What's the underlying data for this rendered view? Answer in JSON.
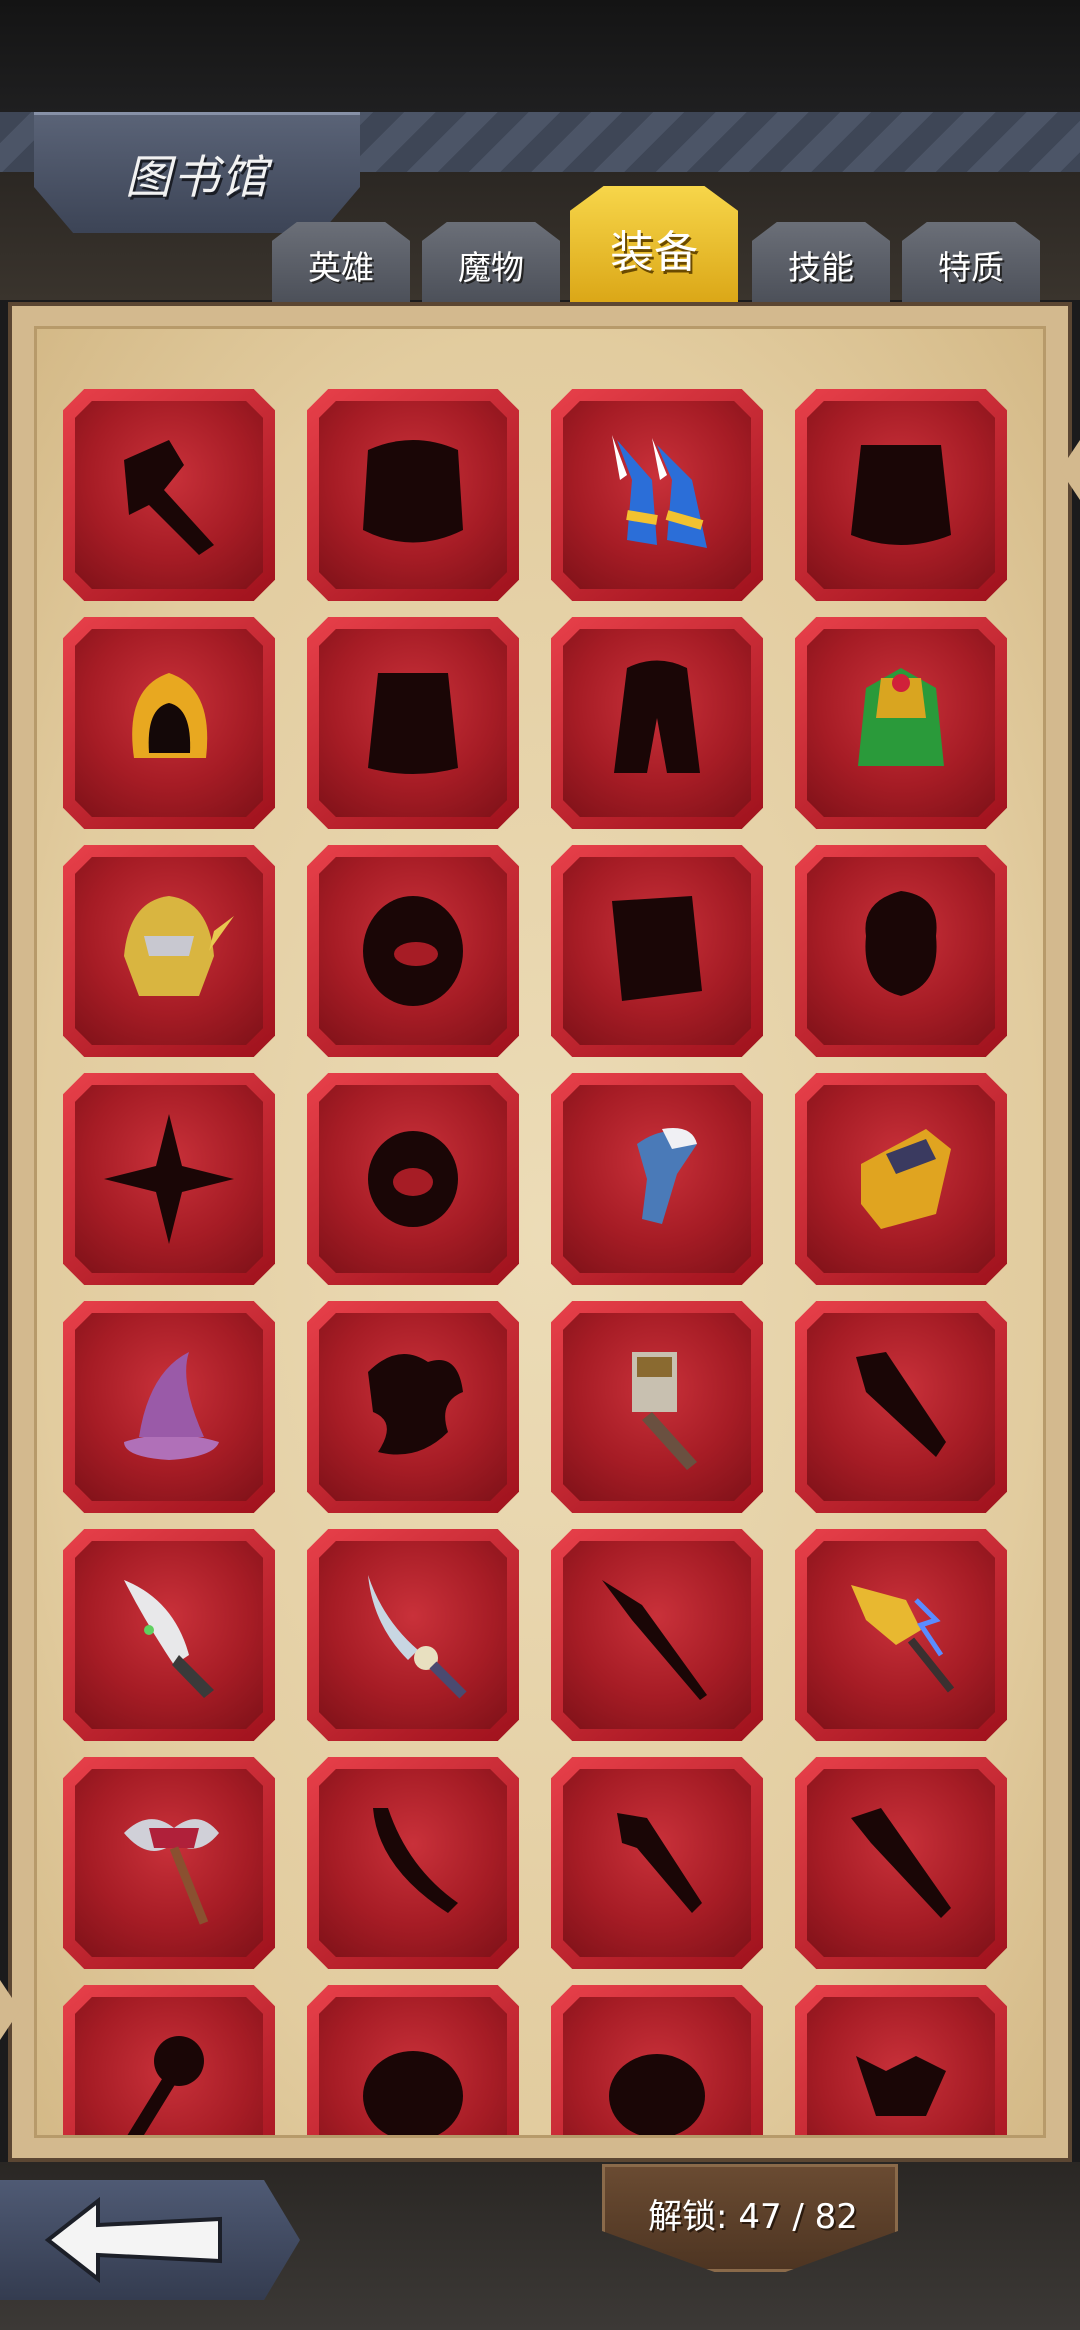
{
  "header": {
    "title": "图书馆"
  },
  "tabs": [
    {
      "label": "英雄",
      "active": false
    },
    {
      "label": "魔物",
      "active": false
    },
    {
      "label": "装备",
      "active": true
    },
    {
      "label": "技能",
      "active": false
    },
    {
      "label": "特质",
      "active": false
    }
  ],
  "unlock": {
    "text": "解锁: 47 / 82"
  },
  "colors": {
    "slot_red": "#b01d27",
    "tab_active": "#e8b824",
    "tab_inactive": "#5a5e67",
    "panel": "#e6d2a8"
  },
  "items": [
    {
      "name": "locked-axe",
      "unlocked": false,
      "icon": "axe-silhouette"
    },
    {
      "name": "locked-armor",
      "unlocked": false,
      "icon": "armor-silhouette"
    },
    {
      "name": "winged-boots",
      "unlocked": true,
      "icon": "winged-boots-icon"
    },
    {
      "name": "locked-cloak",
      "unlocked": false,
      "icon": "cloak-silhouette"
    },
    {
      "name": "golden-hood",
      "unlocked": true,
      "icon": "golden-hood-icon"
    },
    {
      "name": "locked-robe",
      "unlocked": false,
      "icon": "robe-silhouette"
    },
    {
      "name": "locked-cape",
      "unlocked": false,
      "icon": "cape-silhouette"
    },
    {
      "name": "jade-armor",
      "unlocked": true,
      "icon": "jade-armor-icon"
    },
    {
      "name": "golden-helmet",
      "unlocked": true,
      "icon": "golden-helmet-icon"
    },
    {
      "name": "locked-ring",
      "unlocked": false,
      "icon": "ring-silhouette"
    },
    {
      "name": "locked-tome",
      "unlocked": false,
      "icon": "tome-silhouette"
    },
    {
      "name": "locked-amulet",
      "unlocked": false,
      "icon": "amulet-silhouette"
    },
    {
      "name": "locked-shuriken",
      "unlocked": false,
      "icon": "shuriken-silhouette"
    },
    {
      "name": "locked-bracelet",
      "unlocked": false,
      "icon": "bracelet-silhouette"
    },
    {
      "name": "frost-claw",
      "unlocked": true,
      "icon": "frost-claw-icon"
    },
    {
      "name": "golden-gauntlet",
      "unlocked": true,
      "icon": "golden-gauntlet-icon"
    },
    {
      "name": "wizard-hat",
      "unlocked": true,
      "icon": "wizard-hat-icon"
    },
    {
      "name": "locked-dragon",
      "unlocked": false,
      "icon": "dragon-silhouette"
    },
    {
      "name": "war-hammer",
      "unlocked": true,
      "icon": "war-hammer-icon"
    },
    {
      "name": "locked-sword",
      "unlocked": false,
      "icon": "sword-silhouette"
    },
    {
      "name": "green-dagger",
      "unlocked": true,
      "icon": "dagger-icon"
    },
    {
      "name": "skull-blade",
      "unlocked": true,
      "icon": "skull-blade-icon"
    },
    {
      "name": "locked-spear",
      "unlocked": false,
      "icon": "spear-silhouette"
    },
    {
      "name": "lightning-spear",
      "unlocked": true,
      "icon": "lightning-spear-icon"
    },
    {
      "name": "double-axe",
      "unlocked": true,
      "icon": "double-axe-icon"
    },
    {
      "name": "locked-scimitar",
      "unlocked": false,
      "icon": "scimitar-silhouette"
    },
    {
      "name": "locked-greatsword",
      "unlocked": false,
      "icon": "greatsword-silhouette"
    },
    {
      "name": "locked-blade",
      "unlocked": false,
      "icon": "blade-silhouette"
    },
    {
      "name": "locked-staff",
      "unlocked": false,
      "icon": "staff-silhouette"
    },
    {
      "name": "locked-orb",
      "unlocked": false,
      "icon": "orb-silhouette"
    },
    {
      "name": "locked-mace",
      "unlocked": false,
      "icon": "mace-silhouette"
    },
    {
      "name": "locked-skull",
      "unlocked": false,
      "icon": "skull-silhouette"
    }
  ]
}
